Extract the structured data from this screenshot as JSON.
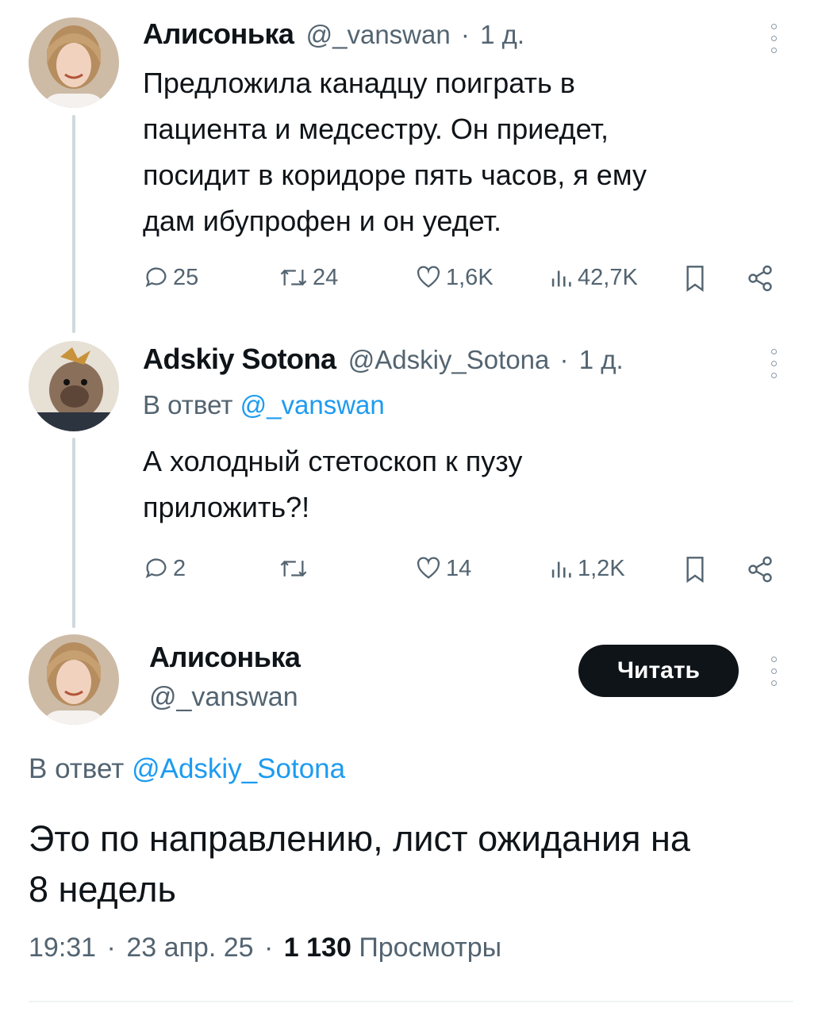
{
  "tweets": [
    {
      "author": "Алисонька",
      "handle": "@_vanswan",
      "sep": "·",
      "time": "1 д.",
      "text_lines": [
        "Предложила канадцу поиграть в",
        "пациента и медсестру. Он приедет,",
        "посидит в коридоре пять часов, я ему",
        "дам ибупрофен и он уедет."
      ],
      "replies": "25",
      "retweets": "24",
      "likes": "1,6K",
      "views": "42,7K"
    },
    {
      "author": "Adskiy Sotona",
      "handle": "@Adskiy_Sotona",
      "sep": "·",
      "time": "1 д.",
      "reply_prefix": "В ответ",
      "reply_to": "@_vanswan",
      "text_lines": [
        "А холодный стетоскоп к пузу",
        "приложить?!"
      ],
      "replies": "2",
      "retweets": "",
      "likes": "14",
      "views": "1,2K"
    }
  ],
  "main_tweet": {
    "author": "Алисонька",
    "handle": "@_vanswan",
    "follow_label": "Читать",
    "reply_prefix": "В ответ",
    "reply_to": "@Adskiy_Sotona",
    "text_lines": [
      "Это по направлению, лист ожидания на",
      "8 недель"
    ],
    "time": "19:31",
    "date": "23 апр. 25",
    "sep": "·",
    "views_count": "1 130",
    "views_label": "Просмотры"
  },
  "icons": {
    "reply": "reply-icon",
    "retweet": "retweet-icon",
    "like": "heart-icon",
    "views": "views-icon",
    "bookmark": "bookmark-icon",
    "share": "share-icon",
    "more": "more-icon"
  },
  "colors": {
    "text": "#0f1419",
    "muted": "#536471",
    "link": "#1d9bf0",
    "thread_line": "#cfd9de",
    "button": "#0f1419"
  }
}
